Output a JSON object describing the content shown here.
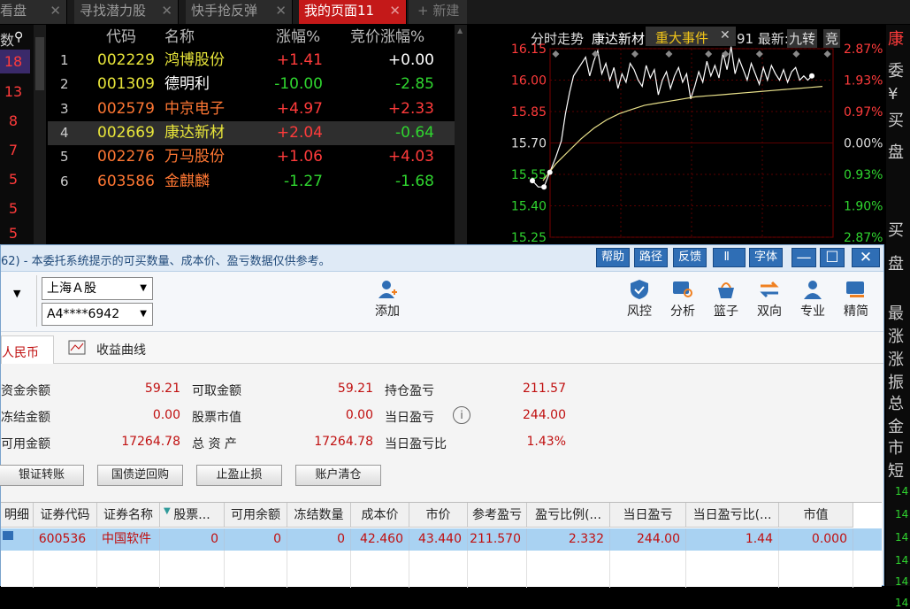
{
  "tabs": [
    {
      "label": "看盘",
      "close": "✕"
    },
    {
      "label": "寻找潜力股",
      "close": "✕"
    },
    {
      "label": "快手抢反弹",
      "close": "✕"
    },
    {
      "label": "我的页面11",
      "close": "✕"
    }
  ],
  "new_tab": "+ 新建",
  "quote_headers": {
    "code": "代码",
    "name": "名称",
    "change": "涨幅%",
    "auction": "竞价涨幅%"
  },
  "left_col": {
    "header": "数",
    "values": [
      "18",
      "13",
      "8",
      "7",
      "5",
      "5",
      "5"
    ]
  },
  "quotes": [
    {
      "idx": "1",
      "code": "002229",
      "name": "鸿博股份",
      "change": "+1.41",
      "auction": "+0.00"
    },
    {
      "idx": "2",
      "code": "001309",
      "name": "德明利",
      "change": "-10.00",
      "auction": "-2.85"
    },
    {
      "idx": "3",
      "code": "002579",
      "name": "中京电子",
      "change": "+4.97",
      "auction": "+2.33"
    },
    {
      "idx": "4",
      "code": "002669",
      "name": "康达新材",
      "change": "+2.04",
      "auction": "-0.64"
    },
    {
      "idx": "5",
      "code": "002276",
      "name": "万马股份",
      "change": "+1.06",
      "auction": "+4.03"
    },
    {
      "idx": "6",
      "code": "603586",
      "name": "金麒麟",
      "change": "-1.27",
      "auction": "-1.68"
    }
  ],
  "chart": {
    "header_left": "分时走势",
    "stock": "康达新材",
    "event_label": "重大事件",
    "event_close": "✕",
    "latest": "91 最新:",
    "tag1": "九转",
    "tag2": "竞",
    "y_prices": [
      "16.15",
      "16.00",
      "15.85",
      "15.70",
      "15.55",
      "15.40",
      "15.25"
    ],
    "y_pcts": [
      "2.87%",
      "1.93%",
      "0.97%",
      "0.00%",
      "0.93%",
      "1.90%",
      "2.87%"
    ],
    "price_points": [
      15.52,
      15.49,
      15.49,
      15.56,
      15.63,
      15.71,
      15.84,
      15.94,
      16.02,
      16.05,
      16.08,
      16.11,
      16.02,
      16.09,
      16.14,
      16.03,
      16.08,
      16.0,
      16.06,
      15.96,
      16.03,
      15.99,
      16.08,
      16.05,
      16.0,
      15.97,
      16.07,
      16.01,
      16.05,
      15.93,
      16.0,
      16.04,
      15.96,
      16.02,
      16.06,
      15.99,
      16.03,
      15.91,
      15.97,
      16.04,
      15.99,
      16.09,
      16.02,
      16.07,
      16.01,
      16.13,
      16.05,
      16.16,
      16.03,
      16.1,
      16.05,
      16.0,
      16.08,
      16.03,
      15.98,
      16.06,
      16.0,
      16.07,
      16.03,
      16.0,
      16.05,
      15.99,
      16.04,
      16.06,
      16.0,
      16.02,
      16.0,
      16.02
    ],
    "avg_points": [
      15.52,
      15.6,
      15.66,
      15.72,
      15.77,
      15.81,
      15.84,
      15.86,
      15.88,
      15.89,
      15.9,
      15.91,
      15.92,
      15.925,
      15.93,
      15.935,
      15.94,
      15.945,
      15.95,
      15.955,
      15.96,
      15.965,
      15.97
    ]
  },
  "right_strip": {
    "top": "康",
    "items": [
      "委",
      "¥",
      "买",
      "盘",
      "买",
      "盘",
      "最",
      "涨",
      "涨",
      "振",
      "总",
      "金",
      "市",
      "短"
    ],
    "nums": [
      "14",
      "14",
      "14",
      "14",
      "14",
      "14"
    ]
  },
  "dialog": {
    "title": "62) - 本委托系统提示的可买数量、成本价、盈亏数据仅供参考。",
    "title_buttons": [
      "帮助",
      "路径",
      "反馈",
      " Ⅱ",
      "字体"
    ],
    "win_min": "—",
    "win_max": "☐",
    "win_close": "✕",
    "market": "上海Ａ股",
    "account": "A4****6942",
    "add_label": "添加",
    "tools": [
      "风控",
      "分析",
      "篮子",
      "双向",
      "专业",
      "精简"
    ],
    "tab_currency": "人民币",
    "tab_curve": "收益曲线",
    "info": {
      "cash_balance_label": "资金余额",
      "cash_balance": "59.21",
      "withdrawable_label": "可取金额",
      "withdrawable": "59.21",
      "position_pl_label": "持仓盈亏",
      "position_pl": "211.57",
      "frozen_label": "冻结金额",
      "frozen": "0.00",
      "market_value_label": "股票市值",
      "market_value": "0.00",
      "day_pl_label": "当日盈亏",
      "day_pl": "244.00",
      "available_label": "可用金额",
      "available": "17264.78",
      "total_assets_label": "总 资 产",
      "total_assets": "17264.78",
      "day_pl_ratio_label": "当日盈亏比",
      "day_pl_ratio": "1.43%"
    },
    "actions": [
      "银证转账",
      "国债逆回购",
      "止盈止损",
      "账户清仓"
    ],
    "grid_headers": [
      "明细",
      "证券代码",
      "证券名称",
      "股票...",
      "可用余额",
      "冻结数量",
      "成本价",
      "市价",
      "参考盈亏",
      "盈亏比例(...",
      "当日盈亏",
      "当日盈亏比(...",
      "市值"
    ],
    "grid_row": [
      "",
      "600536",
      "中国软件",
      "0",
      "0",
      "0",
      "42.460",
      "43.440",
      "211.570",
      "2.332",
      "244.00",
      "1.44",
      "0.000"
    ]
  },
  "colors": {
    "rise": "#ff3b3b",
    "fall": "#2fd52f",
    "active_tab": "#c41919",
    "code": "#e8e53a",
    "dialog_accent": "#2f6eb5"
  }
}
